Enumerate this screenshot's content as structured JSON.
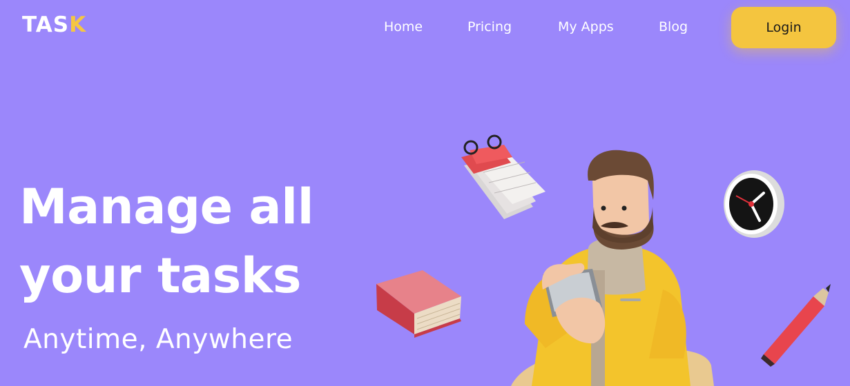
{
  "brand": {
    "logo_text_main": "TAS",
    "logo_text_accent": "K",
    "accent_color": "#f5c642"
  },
  "nav": {
    "links": [
      "Home",
      "Pricing",
      "My Apps",
      "Blog"
    ],
    "login_label": "Login"
  },
  "hero": {
    "title_line1": "Manage all",
    "title_line2": "your tasks",
    "subtitle": "Anytime, Anywhere"
  },
  "theme": {
    "background": "#9b87fb",
    "button_color": "#f4c53f"
  },
  "illustration": {
    "items": [
      "calendar-icon",
      "book-icon",
      "wall-clock-icon",
      "pencil-icon",
      "man-with-tablet-illustration"
    ]
  }
}
